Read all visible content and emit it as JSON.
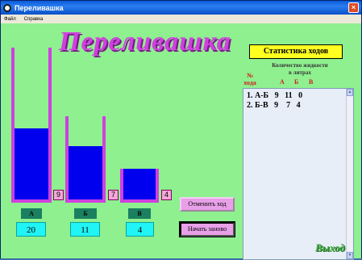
{
  "window": {
    "title": "Переливашка",
    "close": "×"
  },
  "menu": {
    "items": [
      {
        "label": "Файл"
      },
      {
        "label": "Справка"
      }
    ]
  },
  "app": {
    "logo": "Переливашка"
  },
  "vessels": [
    {
      "name": "А",
      "capacity": 20,
      "current": "9",
      "level": 0.47
    },
    {
      "name": "Б",
      "capacity": 11,
      "current": "7",
      "level": 0.64
    },
    {
      "name": "В",
      "capacity": 4,
      "current": "4",
      "level": 1.0
    }
  ],
  "capacity_labels": [
    "20",
    "11",
    "4"
  ],
  "buttons": {
    "undo": "Отменить ход",
    "restart": "Начать заново",
    "exit": "Выход"
  },
  "stats": {
    "title": "Статистика ходов",
    "subtitle_line1": "Количество жидкости",
    "subtitle_line2": "в литрах",
    "num_line1": "№",
    "num_line2": "хода",
    "col_a": "А",
    "col_b": "Б",
    "col_c": "В",
    "rows": [
      {
        "text": "1. А-Б   9   11   0"
      },
      {
        "text": "2. Б-В   9    7   4"
      }
    ]
  },
  "colors": {
    "background": "#8ef08e",
    "liquid": "#0000ee",
    "vessel": "#d040e0",
    "accent": "#ffff20"
  }
}
